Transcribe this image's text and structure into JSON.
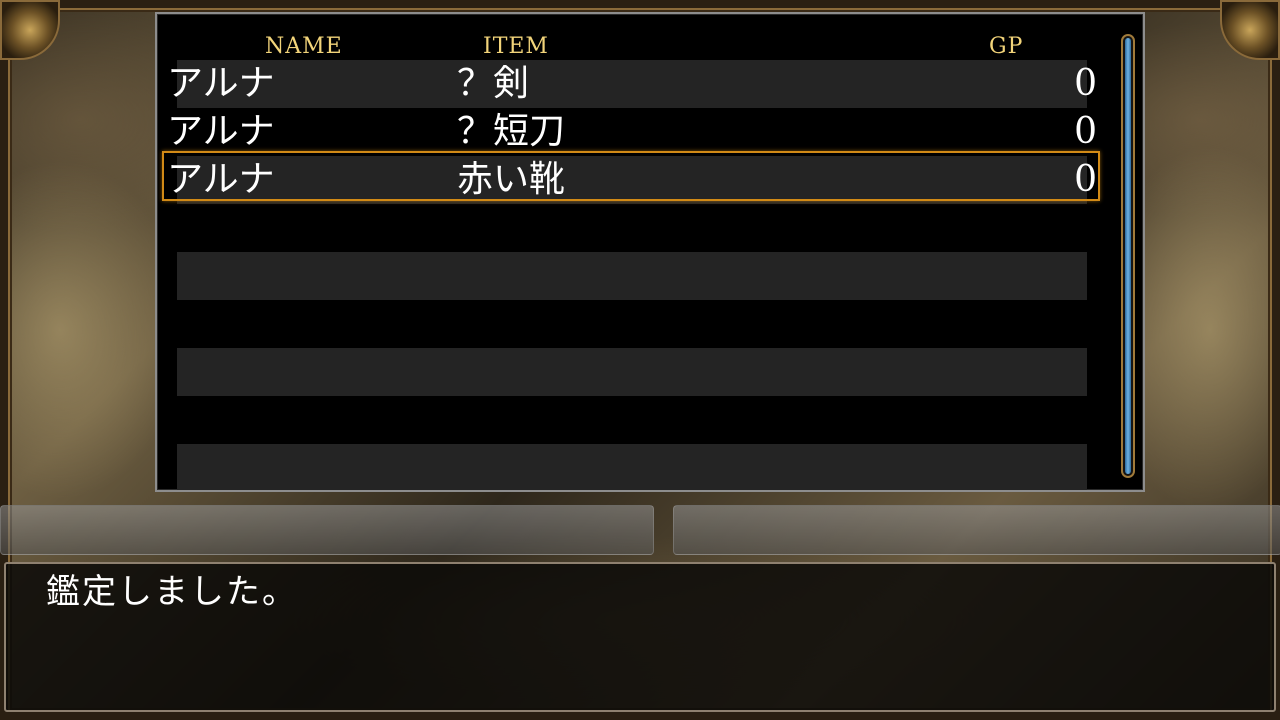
{
  "headers": {
    "name": "NAME",
    "item": "ITEM",
    "gp": "GP"
  },
  "rows": [
    {
      "name": "アルナ",
      "item": "？剣",
      "gp": "0"
    },
    {
      "name": "アルナ",
      "item": "？短刀",
      "gp": "0"
    },
    {
      "name": "アルナ",
      "item": "赤い靴",
      "gp": "0"
    }
  ],
  "selected_row": 3,
  "message": "鑑定しました。",
  "colors": {
    "header_text": "#f2d47a",
    "selection_border": "#d28a16",
    "scroll_thumb": "#6fb2e2"
  }
}
